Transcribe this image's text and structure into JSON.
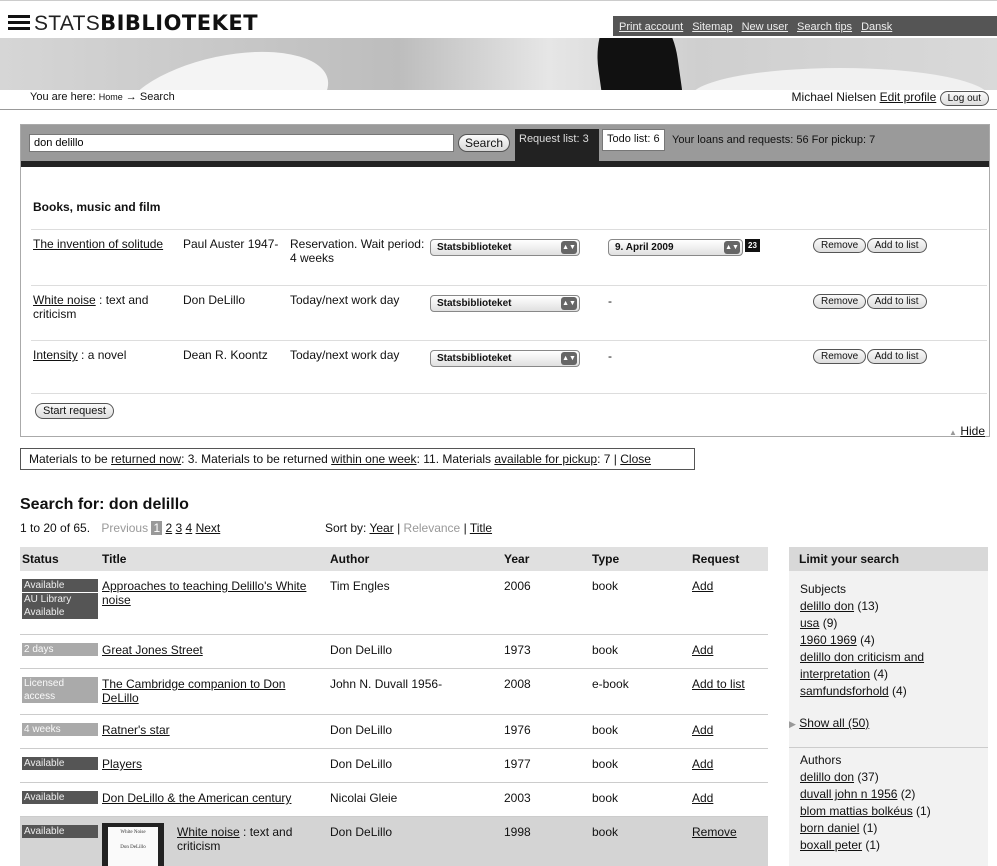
{
  "header": {
    "logo_light": "STATS",
    "logo_bold": "BIBLIOTEKET",
    "nav": [
      "Print account",
      "Sitemap",
      "New user",
      "Search tips",
      "Dansk"
    ]
  },
  "crumb": {
    "prefix": "You are here:",
    "home": "Home",
    "arrow": "→",
    "current": "Search"
  },
  "user": {
    "name": "Michael Nielsen",
    "edit_profile": "Edit profile",
    "logout": "Log out"
  },
  "search": {
    "value": "don delillo",
    "button": "Search",
    "request_list": "Request list: 3",
    "todo_list": "Todo list: 6",
    "loans": "Your loans and requests: 56 For pickup: 7"
  },
  "requests": {
    "section_title": "Books, music and film",
    "rows": [
      {
        "title_link": "The invention of solitude",
        "title_rest": "",
        "author": "Paul Auster 1947-",
        "availability": "Reservation. Wait period: 4 weeks",
        "location": "Statsbiblioteket",
        "date": "9. April 2009",
        "cal_icon": "23"
      },
      {
        "title_link": "White noise",
        "title_rest": " : text and criticism",
        "author": "Don DeLillo",
        "availability": "Today/next work day",
        "location": "Statsbiblioteket",
        "date": "-"
      },
      {
        "title_link": "Intensity",
        "title_rest": " : a novel",
        "author": "Dean R. Koontz",
        "availability": "Today/next work day",
        "location": "Statsbiblioteket",
        "date": "-"
      }
    ],
    "remove": "Remove",
    "add_to_list": "Add to list",
    "start_request": "Start request",
    "hide": "Hide"
  },
  "materials": {
    "t1": "Materials to be ",
    "l1": "returned now",
    "t2": ": 3. Materials to be returned ",
    "l2": "within one week",
    "t3": ": 11. Materials ",
    "l3": "available for pickup",
    "t4": ": 7 | ",
    "close": "Close"
  },
  "results_header": {
    "search_for": "Search for: don delillo",
    "range": "1  to  20 of 65.",
    "previous": "Previous",
    "pages": [
      "1",
      "2",
      "3",
      "4"
    ],
    "next": "Next",
    "sort_by": "Sort by:",
    "sort_year": "Year",
    "sort_relevance": "Relevance",
    "sort_title": "Title"
  },
  "table": {
    "columns": [
      "Status",
      "Title",
      "Author",
      "Year",
      "Type",
      "Request"
    ],
    "rows": [
      {
        "status": [
          "Available",
          "AU Library Available"
        ],
        "title": "Approaches to teaching Delillo's White noise",
        "author": "Tim Engles",
        "year": "2006",
        "type": "book",
        "request": "Add"
      },
      {
        "status": [
          "2 days"
        ],
        "title": "Great Jones Street",
        "author": "Don DeLillo",
        "year": "1973",
        "type": "book",
        "request": "Add"
      },
      {
        "status": [
          "Licensed access"
        ],
        "title": "The Cambridge companion to Don DeLillo",
        "author": "John N. Duvall 1956-",
        "year": "2008",
        "type": "e-book",
        "request": "Add to list"
      },
      {
        "status": [
          "4 weeks"
        ],
        "title": "Ratner's star",
        "author": "Don DeLillo",
        "year": "1976",
        "type": "book",
        "request": "Add"
      },
      {
        "status": [
          "Available"
        ],
        "title": "Players",
        "author": "Don DeLillo",
        "year": "1977",
        "type": "book",
        "request": "Add"
      },
      {
        "status": [
          "Available"
        ],
        "title": "Don DeLillo & the American century",
        "author": "Nicolai Gleie",
        "year": "2003",
        "type": "book",
        "request": "Add"
      },
      {
        "status": [
          "Available"
        ],
        "title_link": "White noise",
        "title_rest": " : text and criticism",
        "author": "Don DeLillo",
        "year": "1998",
        "type": "book",
        "request": "Remove",
        "cover_title": "White Noise",
        "cover_author": "Don DeLillo"
      }
    ]
  },
  "sidebar": {
    "title": "Limit your search",
    "subjects_title": "Subjects",
    "subjects": [
      {
        "link": "delillo don",
        "count": " (13)"
      },
      {
        "link": "usa",
        "count": " (9)"
      },
      {
        "link": "1960 1969",
        "count": " (4)"
      },
      {
        "link": "delillo don criticism and interpretation",
        "count": " (4)"
      },
      {
        "link": "samfundsforhold",
        "count": " (4)"
      }
    ],
    "show_all": "Show all (50)",
    "authors_title": "Authors",
    "authors": [
      {
        "link": "delillo don",
        "count": " (37)"
      },
      {
        "link": "duvall john n 1956",
        "count": " (2)"
      },
      {
        "link": "blom mattias bolkéus",
        "count": " (1)"
      },
      {
        "link": "born daniel",
        "count": " (1)"
      },
      {
        "link": "boxall peter",
        "count": " (1)"
      }
    ]
  },
  "colors": {
    "dark": "#222222",
    "mid": "#555555",
    "light": "#aaaaaa",
    "bar": "#9a9a9a"
  }
}
